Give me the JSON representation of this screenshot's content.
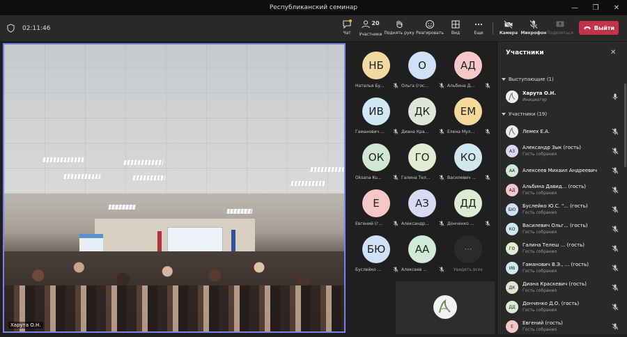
{
  "window": {
    "title": "Республиканский семинар"
  },
  "toolbar": {
    "timer": "02:11:46",
    "chat": "Чат",
    "participants_count": "20",
    "participants": "Участники",
    "raise_hand": "Поднять руку",
    "react": "Реагировать",
    "view": "Вид",
    "more": "Еще",
    "camera": "Камера",
    "mic": "Микрофон",
    "share": "Поделиться",
    "leave": "Выйти"
  },
  "main": {
    "presenter": "Харута О.Н."
  },
  "gallery": [
    {
      "initials": "НБ",
      "name": "Наталья Бу...",
      "color": "#f2d9a0"
    },
    {
      "initials": "О",
      "name": "Ольга (гос...",
      "color": "#cfe1f7"
    },
    {
      "initials": "АД",
      "name": "Альбина Д...",
      "color": "#f5c7c7"
    },
    {
      "initials": "ИВ",
      "name": "Гаманович ...",
      "color": "#cfe8f4"
    },
    {
      "initials": "ДК",
      "name": "Диана Кра...",
      "color": "#dfe6d5"
    },
    {
      "initials": "ЕМ",
      "name": "Елена Мул...",
      "color": "#f6d99a"
    },
    {
      "initials": "ОК",
      "name": "Oksana Ku...",
      "color": "#cfe8d2"
    },
    {
      "initials": "ГО",
      "name": "Галина Тел...",
      "color": "#e2ecd0"
    },
    {
      "initials": "КО",
      "name": "Василевич ...",
      "color": "#cfe7ee"
    },
    {
      "initials": "Е",
      "name": "Евгений (г...",
      "color": "#f5c7c7"
    },
    {
      "initials": "АЗ",
      "name": "Александр...",
      "color": "#d9d9f3"
    },
    {
      "initials": "ДД",
      "name": "Донченко ...",
      "color": "#dcecd3"
    },
    {
      "initials": "БЮ",
      "name": "Буслейко ...",
      "color": "#cfe1f7"
    },
    {
      "initials": "АА",
      "name": "Алексеев ...",
      "color": "#cfead6"
    },
    {
      "initials": "···",
      "name": "Увидеть всех",
      "color": "#2a2a2a"
    }
  ],
  "panel": {
    "title": "Участники",
    "presenters_header": "Выступающие (1)",
    "attendees_header": "Участники (19)",
    "presenter": {
      "name": "Харута О.Н.",
      "role": "Инициатор"
    },
    "attendees": [
      {
        "initials": "",
        "name": "Лемех Е.А.",
        "sub": "",
        "color": "#eaeaea"
      },
      {
        "initials": "АЗ",
        "name": "Александр Зык (гость)",
        "sub": "Гость собрания",
        "color": "#d9d9f3"
      },
      {
        "initials": "АА",
        "name": "Алексеев Михаил Андреевич",
        "sub": "",
        "color": "#cfead6"
      },
      {
        "initials": "АД",
        "name": "Альбина Давид...  (гость)",
        "sub": "Гость собрания",
        "color": "#f5c7c7"
      },
      {
        "initials": "БЮ",
        "name": "Буслейко Ю.С. \"...  (гость)",
        "sub": "Гость собрания",
        "color": "#cfe1f7"
      },
      {
        "initials": "КО",
        "name": "Василевич Ольг...  (гость)",
        "sub": "Гость собрания",
        "color": "#cfe7ee"
      },
      {
        "initials": "ГО",
        "name": "Галина Телеш ...  (гость)",
        "sub": "Гость собрания",
        "color": "#e2ecd0"
      },
      {
        "initials": "ИВ",
        "name": "Гаманович В.Э., ...  (гость)",
        "sub": "Гость собрания",
        "color": "#cfe8f4"
      },
      {
        "initials": "ДК",
        "name": "Диана Краскевич (гость)",
        "sub": "Гость собрания",
        "color": "#dfe6d5"
      },
      {
        "initials": "ДД",
        "name": "Донченко Д.О. (гость)",
        "sub": "Гость собрания",
        "color": "#dcecd3"
      },
      {
        "initials": "Е",
        "name": "Евгений (гость)",
        "sub": "Гость собрания",
        "color": "#f5c7c7"
      }
    ]
  }
}
